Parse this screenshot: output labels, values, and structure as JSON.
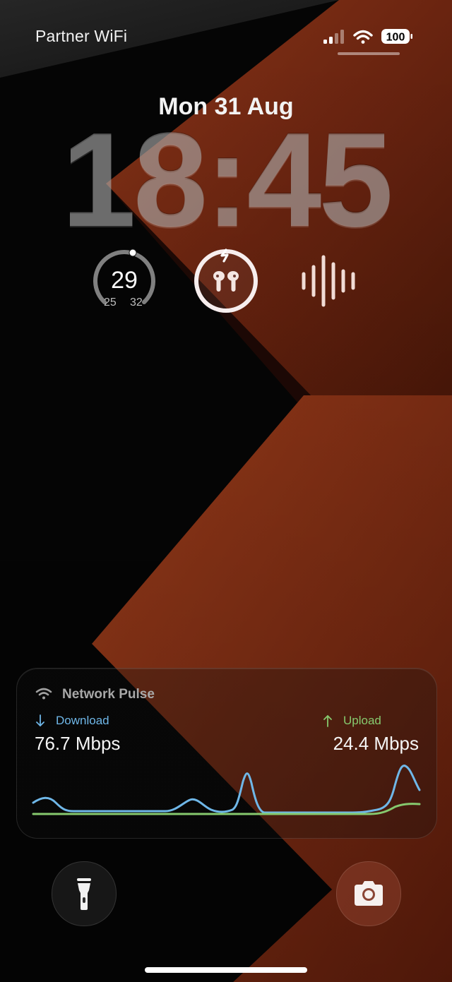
{
  "status_bar": {
    "carrier": "Partner WiFi",
    "battery": "100",
    "signal_icon": "cellular-signal-icon",
    "wifi_icon": "wifi-icon",
    "battery_icon": "battery-icon"
  },
  "lock_screen": {
    "date": "Mon 31 Aug",
    "time": "18:45"
  },
  "widgets": {
    "weather": {
      "current": "29",
      "low": "25",
      "high": "32",
      "icon": "temperature-gauge-icon"
    },
    "airpods": {
      "icon": "airpods-charging-icon"
    },
    "voice": {
      "icon": "voice-waveform-icon"
    }
  },
  "network_card": {
    "title": "Network Pulse",
    "download_label": "Download",
    "download_value": "76.7 Mbps",
    "upload_label": "Upload",
    "upload_value": "24.4 Mbps",
    "colors": {
      "download": "#6fb7e8",
      "upload": "#86c96e"
    }
  },
  "quick_actions": {
    "flashlight_icon": "flashlight-icon",
    "camera_icon": "camera-icon"
  },
  "colors": {
    "wallpaper_dark": "#050505",
    "wallpaper_rust": "#6b2411",
    "wallpaper_rust_light": "#a2401f"
  }
}
